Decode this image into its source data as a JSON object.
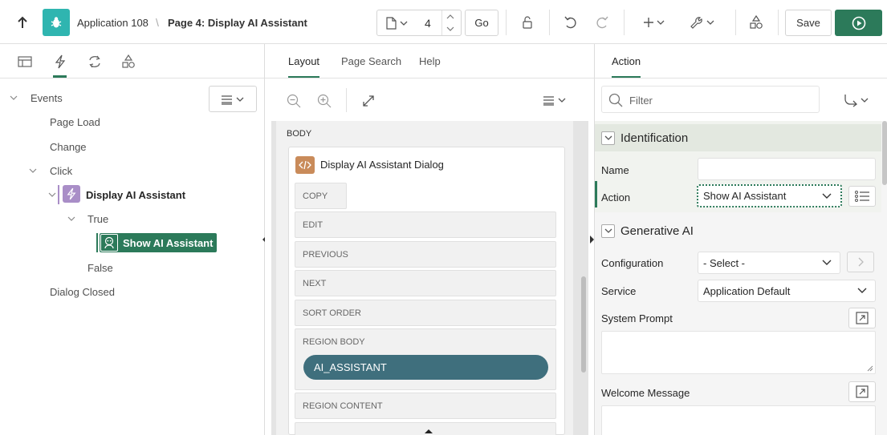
{
  "header": {
    "app_label": "Application 108",
    "separator": "\\",
    "page_label": "Page 4: Display AI Assistant",
    "page_number": "4",
    "go_label": "Go",
    "save_label": "Save"
  },
  "left": {
    "tree": {
      "events_label": "Events",
      "page_load": "Page Load",
      "change": "Change",
      "click": "Click",
      "dynamic_action": "Display AI Assistant",
      "true_label": "True",
      "action": "Show AI Assistant",
      "false_label": "False",
      "dialog_closed": "Dialog Closed"
    }
  },
  "middle": {
    "tabs": [
      "Layout",
      "Page Search",
      "Help"
    ],
    "body_label": "BODY",
    "region_title": "Display AI Assistant Dialog",
    "positions": [
      "COPY",
      "EDIT",
      "PREVIOUS",
      "NEXT",
      "SORT ORDER",
      "REGION BODY",
      "REGION CONTENT"
    ],
    "item_label": "AI_ASSISTANT"
  },
  "right": {
    "tab": "Action",
    "filter_placeholder": "Filter",
    "identification": {
      "title": "Identification",
      "name_label": "Name",
      "name_value": "",
      "action_label": "Action",
      "action_value": "Show AI Assistant"
    },
    "generative_ai": {
      "title": "Generative AI",
      "configuration_label": "Configuration",
      "configuration_value": "- Select -",
      "service_label": "Service",
      "service_value": "Application Default",
      "system_prompt_label": "System Prompt",
      "welcome_message_label": "Welcome Message"
    }
  },
  "colors": {
    "accent_green": "#2c7a5a",
    "app_icon_teal": "#2fb5b0",
    "ai_item_fill": "#3f6f7d",
    "dynamic_action_icon": "#a98ec7",
    "region_icon": "#c98b5a",
    "section_header_bg": "#e3e8e0"
  },
  "icons": [
    "up-arrow-icon",
    "app-bug-icon",
    "page-icon",
    "lock-icon",
    "undo-icon",
    "redo-icon",
    "plus-icon",
    "wrench-icon",
    "shapes-icon",
    "run-icon",
    "hamburger-icon",
    "zoom-out-icon",
    "zoom-in-icon",
    "expand-icon",
    "search-icon",
    "route-icon",
    "chevron-down-icon",
    "list-icon",
    "external-open-icon"
  ]
}
